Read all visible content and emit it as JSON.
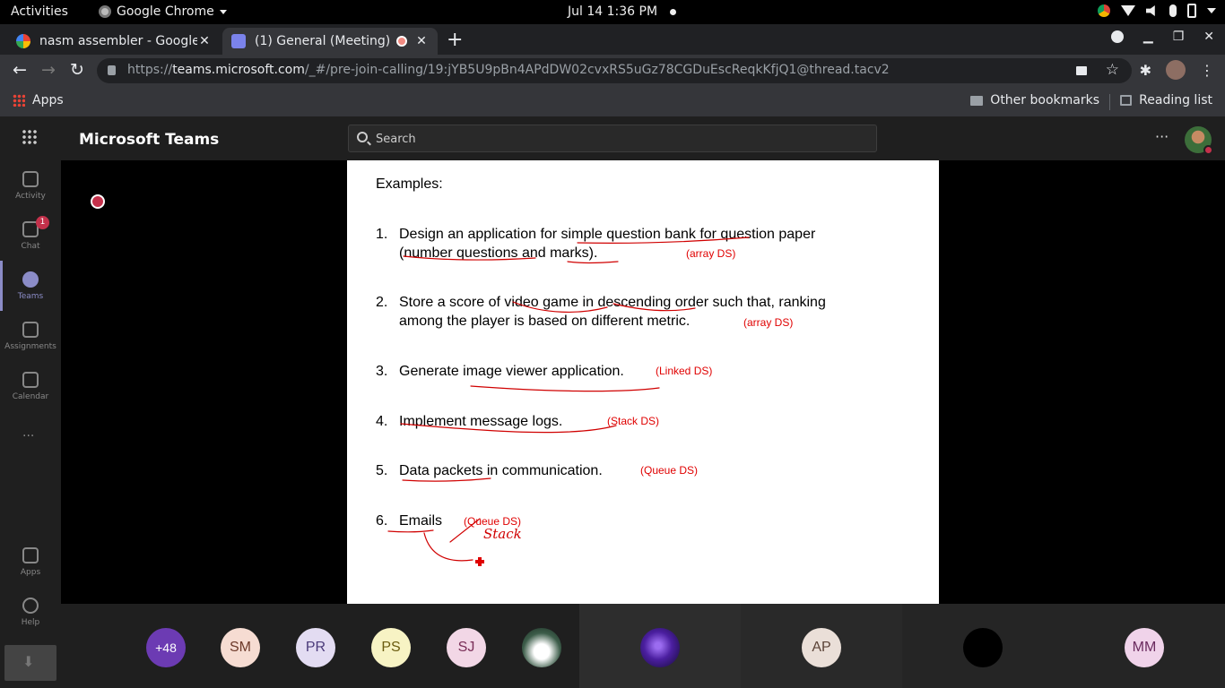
{
  "system": {
    "activities": "Activities",
    "app_name": "Google Chrome",
    "clock": "Jul 14   1:36 PM"
  },
  "browser": {
    "tabs": [
      {
        "title": "nasm assembler - Google",
        "icon": "google-icon",
        "active": false
      },
      {
        "title": "(1) General (Meeting) |",
        "icon": "teams-icon",
        "active": true,
        "recording": true
      }
    ],
    "url_prefix": "https://",
    "url_domain": "teams.microsoft.com",
    "url_path": "/_#/pre-join-calling/19:jYB5U9pBn4APdDW02cvxRS5uGz78CGDuEscReqkKfjQ1@thread.tacv2",
    "bookmarks": {
      "apps": "Apps",
      "other": "Other bookmarks",
      "reading_list": "Reading list"
    }
  },
  "teams": {
    "title": "Microsoft Teams",
    "search_placeholder": "Search",
    "rail": [
      {
        "label": "Activity",
        "icon": "bell-icon"
      },
      {
        "label": "Chat",
        "icon": "chat-icon",
        "badge": "1"
      },
      {
        "label": "Teams",
        "icon": "teams-icon",
        "active": true
      },
      {
        "label": "Assignments",
        "icon": "assignments-icon"
      },
      {
        "label": "Calendar",
        "icon": "calendar-icon"
      }
    ],
    "rail_bottom": [
      {
        "label": "Apps",
        "icon": "apps-icon"
      },
      {
        "label": "Help",
        "icon": "help-icon"
      }
    ]
  },
  "slide": {
    "heading": "Examples:",
    "items": [
      {
        "num": "1.",
        "text": "Design an application for simple question bank for question paper",
        "text2": "(number questions and marks).",
        "tag": "(array DS)"
      },
      {
        "num": "2.",
        "text": "Store a score of video game in descending order such that, ranking",
        "text2": "among the player is based on different metric.",
        "tag": "(array DS)"
      },
      {
        "num": "3.",
        "text": "Generate image viewer application.",
        "tag": "(Linked DS)"
      },
      {
        "num": "4.",
        "text": "Implement message logs.",
        "tag": "(Stack DS)"
      },
      {
        "num": "5.",
        "text": "Data packets in communication.",
        "tag": "(Queue DS)"
      },
      {
        "num": "6.",
        "text": "Emails",
        "tag": "(Queue DS)"
      }
    ],
    "handwritten": "Stack"
  },
  "participants": {
    "overflow": "+48",
    "avatars": [
      {
        "initials": "SM",
        "bg": "#f6dcd2",
        "fg": "#6d3a2a"
      },
      {
        "initials": "PR",
        "bg": "#e3dcf2",
        "fg": "#4b3b7a"
      },
      {
        "initials": "PS",
        "bg": "#f7f3c4",
        "fg": "#6b5c10"
      },
      {
        "initials": "SJ",
        "bg": "#f2d7e6",
        "fg": "#7a2f58"
      }
    ],
    "tiles": [
      {
        "initials": "",
        "kind": "photo"
      },
      {
        "initials": "AP",
        "bg": "#eadfd8",
        "fg": "#5b4337"
      },
      {
        "initials": "",
        "kind": "black"
      },
      {
        "initials": "MM",
        "bg": "#f0d3ea",
        "fg": "#6a2a5e"
      }
    ]
  }
}
